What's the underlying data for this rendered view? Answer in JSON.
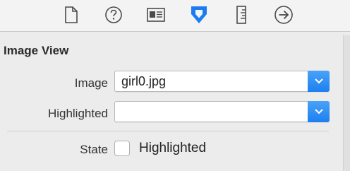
{
  "toolbar": {
    "tabs": [
      {
        "icon": "file-icon"
      },
      {
        "icon": "help-icon"
      },
      {
        "icon": "identity-icon"
      },
      {
        "icon": "attributes-icon",
        "selected": true
      },
      {
        "icon": "size-ruler-icon"
      },
      {
        "icon": "connections-icon"
      }
    ],
    "accent_color": "#1a7cf0"
  },
  "section": {
    "title": "Image View"
  },
  "fields": {
    "image": {
      "label": "Image",
      "value": "girl0.jpg"
    },
    "highlighted": {
      "label": "Highlighted",
      "value": ""
    },
    "state": {
      "label": "State",
      "checkbox_label": "Highlighted",
      "checked": false
    }
  }
}
